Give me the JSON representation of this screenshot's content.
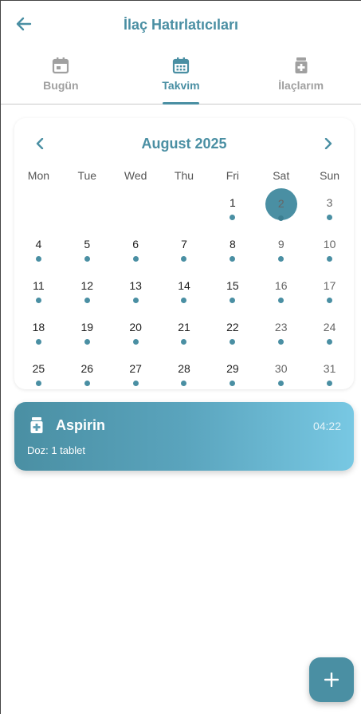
{
  "header": {
    "title": "İlaç Hatırlatıcıları",
    "back_icon": "arrow-left-icon"
  },
  "tabs": [
    {
      "label": "Bugün",
      "icon": "calendar-today-icon",
      "active": false
    },
    {
      "label": "Takvim",
      "icon": "calendar-month-icon",
      "active": true
    },
    {
      "label": "İlaçlarım",
      "icon": "medication-icon",
      "active": false
    }
  ],
  "calendar": {
    "month_label": "August 2025",
    "weekdays": [
      "Mon",
      "Tue",
      "Wed",
      "Thu",
      "Fri",
      "Sat",
      "Sun"
    ],
    "leading_blanks": 4,
    "days": [
      "1",
      "2",
      "3",
      "4",
      "5",
      "6",
      "7",
      "8",
      "9",
      "10",
      "11",
      "12",
      "13",
      "14",
      "15",
      "16",
      "17",
      "18",
      "19",
      "20",
      "21",
      "22",
      "23",
      "24",
      "25",
      "26",
      "27",
      "28",
      "29",
      "30",
      "31"
    ],
    "selected_day": "2",
    "marked_days_all": true
  },
  "medication_card": {
    "name": "Aspirin",
    "time": "04:22",
    "dose": "Doz: 1 tablet",
    "icon": "medication-icon"
  },
  "fab": {
    "icon": "plus-icon"
  },
  "colors": {
    "accent": "#4a8fa3",
    "gradient_end": "#78c8e3",
    "inactive_tab": "#a0a0a0"
  }
}
